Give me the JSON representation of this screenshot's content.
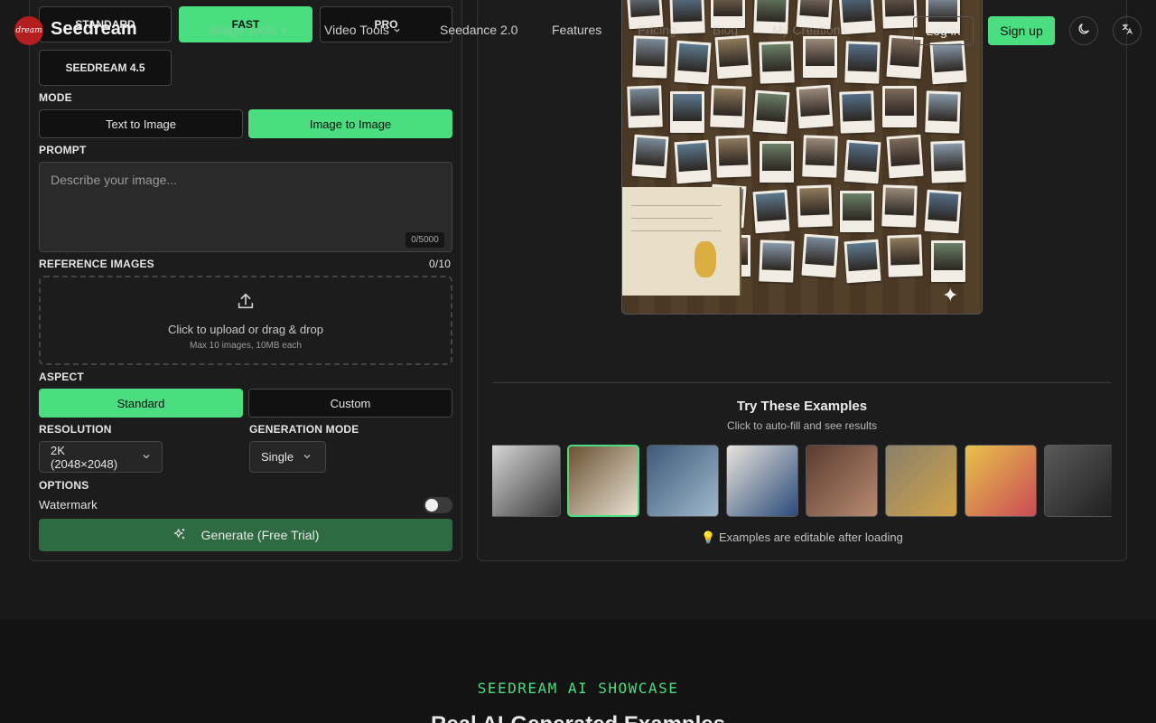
{
  "brand": {
    "logo_text": "dream",
    "name": "Seedream"
  },
  "nav": {
    "items": [
      {
        "label": "Image Tools",
        "faded": true,
        "dropdown": true
      },
      {
        "label": "Video Tools",
        "faded": false,
        "dropdown": true
      },
      {
        "label": "Seedance 2.0",
        "faded": false,
        "dropdown": false
      },
      {
        "label": "Features",
        "faded": false,
        "dropdown": false
      },
      {
        "label": "Pricing",
        "faded": true,
        "dropdown": false
      },
      {
        "label": "Blog",
        "faded": true,
        "dropdown": false
      },
      {
        "label": "My Creations",
        "faded": true,
        "dropdown": false
      }
    ],
    "login": "Log in",
    "signup": "Sign up",
    "theme_icon": "moon-icon",
    "language_icon": "translate-icon"
  },
  "model": {
    "options": [
      "STANDARD",
      "FAST",
      "PRO",
      "SEEDREAM 4.5"
    ],
    "selected": "FAST"
  },
  "mode": {
    "label": "MODE",
    "options": [
      "Text to Image",
      "Image to Image"
    ],
    "selected": "Image to Image"
  },
  "prompt": {
    "label": "PROMPT",
    "placeholder": "Describe your image...",
    "counter": "0/5000"
  },
  "reference": {
    "label": "REFERENCE IMAGES",
    "count": "0/10",
    "upload_text": "Click to upload or drag & drop",
    "upload_hint": "Max 10 images, 10MB each"
  },
  "aspect": {
    "label": "ASPECT",
    "options": [
      "Standard",
      "Custom"
    ],
    "selected": "Standard"
  },
  "resolution": {
    "label": "RESOLUTION",
    "value": "2K (2048×2048)"
  },
  "generation_mode": {
    "label": "GENERATION MODE",
    "value": "Single"
  },
  "options": {
    "label": "OPTIONS",
    "watermark_label": "Watermark",
    "watermark_on": false
  },
  "generate_label": "Generate (Free Trial)",
  "examples": {
    "title": "Try These Examples",
    "subtitle": "Click to auto-fill and see results",
    "note": "💡 Examples are editable after loading",
    "thumbnails": [
      {
        "name": "woman-street-bw",
        "colors": [
          "#d9d9d9",
          "#3a3a3a"
        ]
      },
      {
        "name": "polaroid-wall",
        "colors": [
          "#6b5234",
          "#e9e2d2"
        ],
        "active": true
      },
      {
        "name": "glitch-portrait",
        "colors": [
          "#3d5a78",
          "#9fb8cc"
        ]
      },
      {
        "name": "sketch-portrait",
        "colors": [
          "#e9e4dc",
          "#294a7a"
        ]
      },
      {
        "name": "fitness-collage",
        "colors": [
          "#5a3b30",
          "#b78b6f"
        ]
      },
      {
        "name": "gold-letters",
        "colors": [
          "#8a8069",
          "#d0a34a"
        ]
      },
      {
        "name": "color-collage",
        "colors": [
          "#e8c24a",
          "#c94b56"
        ]
      },
      {
        "name": "leather-jacket-bw",
        "colors": [
          "#5a5a5a",
          "#1e1e1e"
        ]
      }
    ]
  },
  "showcase": {
    "kicker": "SEEDREAM AI SHOWCASE",
    "heading": "Real AI-Generated Examples"
  }
}
